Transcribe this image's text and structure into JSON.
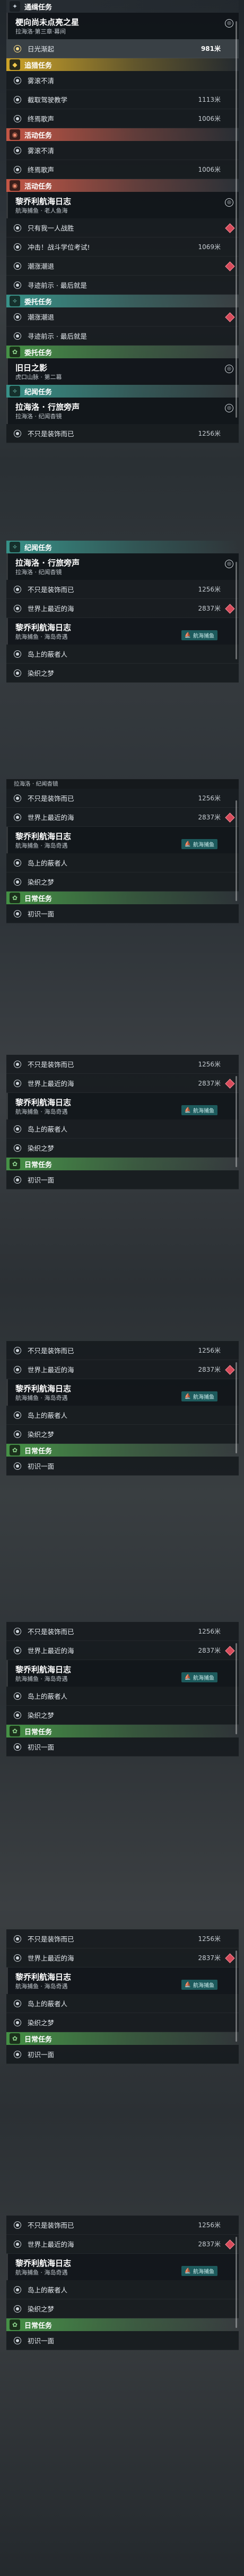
{
  "colors": {
    "yellow": "#d6aa28",
    "red": "#cc5846",
    "teal": "#38968c",
    "green": "#469646",
    "lock": "#d84b5b",
    "selected": "#ffe08a"
  },
  "labels": {
    "cat_wanted": "通缉任务",
    "cat_hunt": "追猎任务",
    "cat_event": "活动任务",
    "cat_side": "委托任务",
    "cat_sea": "纪闻任务",
    "cat_daily": "日常任务",
    "t_star": "梗向尚未点亮之星",
    "t_star_sub": "拉海洛·第三章·幕间",
    "r_rise": "日光渐起",
    "r_rise_dist": "981米",
    "r_fog": "雾滚不清",
    "r_tech": "截取驾驶教学",
    "r_tech_dist": "1113米",
    "r_end": "终焉歌声",
    "r_end_dist": "1006米",
    "t_log": "黎乔利航海日志",
    "t_log_sub1": "航海捕鱼 · 老人鱼海",
    "t_log_sub2": "航海捕鱼 · 海岛奇遇",
    "r_person": "只有我一人战胜",
    "r_rush": "冲击！战斗学位考试!",
    "r_rush_dist": "1069米",
    "r_tide": "潮涨潮退",
    "r_hunt": "寻迹前示 · 最后就是",
    "t_shadow": "旧日之影",
    "t_shadow_sub": "虎口山脉 · 第二幕",
    "t_rumor": "拉海洛 · 行旅旁声",
    "t_rumor_sub": "拉海洛 · 纪闻杳镜",
    "r_nofit": "不只是装饰而已",
    "r_nofit_dist": "1256米",
    "r_sea": "世界上最近的海",
    "r_sea_dist": "2837米",
    "r_island": "岛上的蔽者人",
    "r_dye": "染织之梦",
    "r_meet": "初识一面",
    "tag_fishing": "航海捕鱼"
  }
}
